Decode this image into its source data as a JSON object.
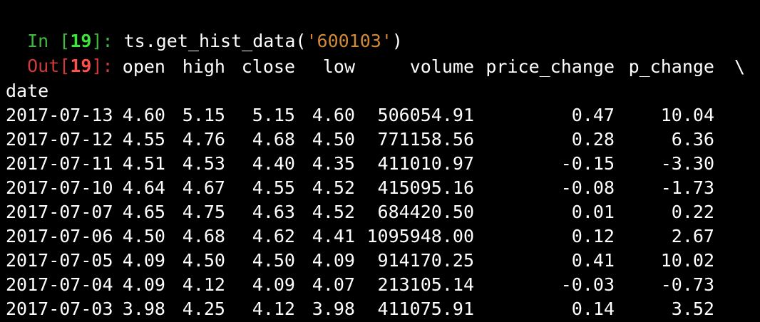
{
  "input": {
    "prompt_label": "In [",
    "prompt_number": "19",
    "prompt_end": "]: ",
    "code_before": "ts.get_hist_data(",
    "code_string": "'600103'",
    "code_after": ")"
  },
  "output": {
    "prompt_label": "Out[",
    "prompt_number": "19",
    "prompt_end": "]:"
  },
  "table": {
    "columns": [
      "open",
      "high",
      "close",
      "low",
      "volume",
      "price_change",
      "p_change"
    ],
    "continuation": "\\",
    "index_name": "date",
    "rows": [
      {
        "date": "2017-07-13",
        "open": "4.60",
        "high": "5.15",
        "close": "5.15",
        "low": "4.60",
        "volume": "506054.91",
        "price_change": "0.47",
        "p_change": "10.04"
      },
      {
        "date": "2017-07-12",
        "open": "4.55",
        "high": "4.76",
        "close": "4.68",
        "low": "4.50",
        "volume": "771158.56",
        "price_change": "0.28",
        "p_change": "6.36"
      },
      {
        "date": "2017-07-11",
        "open": "4.51",
        "high": "4.53",
        "close": "4.40",
        "low": "4.35",
        "volume": "411010.97",
        "price_change": "-0.15",
        "p_change": "-3.30"
      },
      {
        "date": "2017-07-10",
        "open": "4.64",
        "high": "4.67",
        "close": "4.55",
        "low": "4.52",
        "volume": "415095.16",
        "price_change": "-0.08",
        "p_change": "-1.73"
      },
      {
        "date": "2017-07-07",
        "open": "4.65",
        "high": "4.75",
        "close": "4.63",
        "low": "4.52",
        "volume": "684420.50",
        "price_change": "0.01",
        "p_change": "0.22"
      },
      {
        "date": "2017-07-06",
        "open": "4.50",
        "high": "4.68",
        "close": "4.62",
        "low": "4.41",
        "volume": "1095948.00",
        "price_change": "0.12",
        "p_change": "2.67"
      },
      {
        "date": "2017-07-05",
        "open": "4.09",
        "high": "4.50",
        "close": "4.50",
        "low": "4.09",
        "volume": "914170.25",
        "price_change": "0.41",
        "p_change": "10.02"
      },
      {
        "date": "2017-07-04",
        "open": "4.09",
        "high": "4.12",
        "close": "4.09",
        "low": "4.07",
        "volume": "213105.14",
        "price_change": "-0.03",
        "p_change": "-0.73"
      },
      {
        "date": "2017-07-03",
        "open": "3.98",
        "high": "4.25",
        "close": "4.12",
        "low": "3.98",
        "volume": "411075.91",
        "price_change": "0.14",
        "p_change": "3.52"
      }
    ]
  },
  "colors": {
    "background": "#000000",
    "text": "#ffffff",
    "in_prompt": "#3fb93f",
    "out_prompt": "#d03a3a",
    "string_literal": "#d08a3a"
  }
}
